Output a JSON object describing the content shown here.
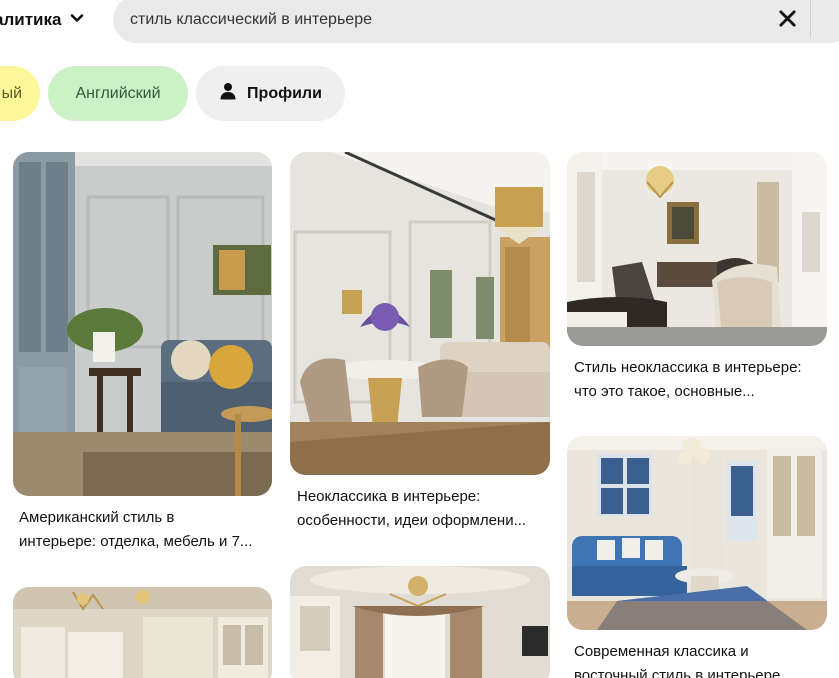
{
  "header": {
    "filter_label": "алитика",
    "search_value": "стиль классический в интерьере"
  },
  "chips": [
    {
      "label": "ый"
    },
    {
      "label": "Английский"
    },
    {
      "label": "Профили"
    }
  ],
  "pins": [
    {
      "title_line1": "Американский стиль в",
      "title_line2": "интерьере: отделка, мебель и 7..."
    },
    {
      "title_line1": "Неоклассика в интерьере:",
      "title_line2": "особенности, идеи оформлени..."
    },
    {
      "title_line1": "Стиль неоклассика в интерьере:",
      "title_line2": "что это такое, основные..."
    },
    {
      "title_line1": "Современная классика и",
      "title_line2": "восточный стиль в интерьере..."
    }
  ],
  "colors": {
    "search_bg": "#e9e9e9",
    "chip_yellow": "#fcf89a",
    "chip_green": "#ccf1c6",
    "chip_gray": "#efefef"
  }
}
